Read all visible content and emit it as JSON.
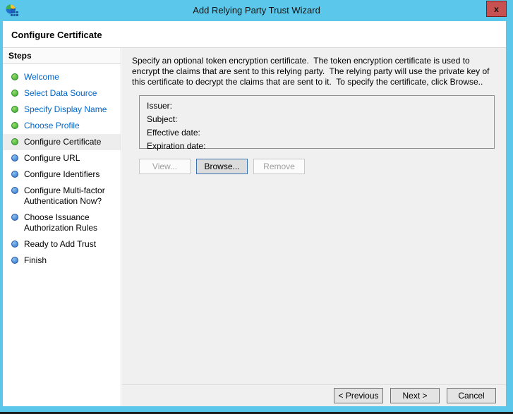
{
  "window": {
    "title": "Add Relying Party Trust Wizard",
    "close_label": "x",
    "page_title": "Configure Certificate"
  },
  "sidebar": {
    "header": "Steps",
    "items": [
      {
        "label": "Welcome",
        "state": "done"
      },
      {
        "label": "Select Data Source",
        "state": "done"
      },
      {
        "label": "Specify Display Name",
        "state": "done"
      },
      {
        "label": "Choose Profile",
        "state": "done"
      },
      {
        "label": "Configure Certificate",
        "state": "current"
      },
      {
        "label": "Configure URL",
        "state": "upcoming"
      },
      {
        "label": "Configure Identifiers",
        "state": "upcoming"
      },
      {
        "label": "Configure Multi-factor Authentication Now?",
        "state": "upcoming"
      },
      {
        "label": "Choose Issuance Authorization Rules",
        "state": "upcoming"
      },
      {
        "label": "Ready to Add Trust",
        "state": "upcoming"
      },
      {
        "label": "Finish",
        "state": "upcoming"
      }
    ]
  },
  "main": {
    "description": "Specify an optional token encryption certificate.  The token encryption certificate is used to encrypt the claims that are sent to this relying party.  The relying party will use the private key of this certificate to decrypt the claims that are sent to it.  To specify the certificate, click Browse..",
    "certificate": {
      "field_labels": [
        "Issuer:",
        "Subject:",
        "Effective date:",
        "Expiration date:"
      ]
    },
    "buttons": {
      "view": "View...",
      "browse": "Browse...",
      "remove": "Remove"
    }
  },
  "footer": {
    "previous": "< Previous",
    "next": "Next >",
    "cancel": "Cancel"
  },
  "colors": {
    "titlebar_blue": "#5BC8EB",
    "close_red": "#C75050",
    "link_blue": "#0066CC",
    "done_green": "#3aa331",
    "upcoming_blue": "#2a6fc9",
    "main_bg": "#f0f0f0"
  }
}
